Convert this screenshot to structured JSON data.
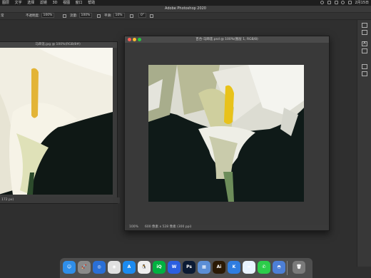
{
  "menubar": {
    "items": [
      "选择",
      "滤镜",
      "3D",
      "视图",
      "窗口",
      "帮助"
    ],
    "edge_items": [
      "图层",
      "文字"
    ],
    "clock": "2月15日"
  },
  "app": {
    "title": "Adobe Photoshop 2020"
  },
  "options": {
    "brush_mode": "正常",
    "opacity_label": "不透明度:",
    "opacity_value": "100%",
    "flow_label": "流量:",
    "flow_value": "100%",
    "smooth_label": "平滑:",
    "smooth_value": "10%",
    "angle_value": "0°",
    "left_edge_value": "常"
  },
  "doc_left": {
    "title": "马蹄莲.jpg @ 100%(RGB/8#)",
    "status": "172 px)"
  },
  "doc_front": {
    "title": "百合-马蹄莲.psd @ 100%(图层 1, RGB/8)",
    "zoom": "100%",
    "size": "600 像素 x 528 像素 (300 ppi)"
  },
  "right_panel": {
    "tools": [
      "brush-tool",
      "type-tool",
      "paragraph-tool",
      "adjustments-tool",
      "properties-tool"
    ]
  },
  "dock": {
    "apps": [
      {
        "name": "Finder",
        "label": "☺",
        "color": "#2f8ee8"
      },
      {
        "name": "Launchpad",
        "label": "🚀",
        "color": "#8a8a8a"
      },
      {
        "name": "Safari",
        "label": "◎",
        "color": "#2a6fd6"
      },
      {
        "name": "Chrome",
        "label": "◉",
        "color": "#e0e0e0"
      },
      {
        "name": "App Store",
        "label": "A",
        "color": "#1c8bf0"
      },
      {
        "name": "QQ",
        "label": "🐧",
        "color": "#eeeeee"
      },
      {
        "name": "iQIYI",
        "label": "iQ",
        "color": "#00b140"
      },
      {
        "name": "WPS",
        "label": "W",
        "color": "#2b5fe0"
      },
      {
        "name": "Photoshop",
        "label": "Ps",
        "color": "#0b1a33"
      },
      {
        "name": "Preview",
        "label": "▦",
        "color": "#5b8ed6"
      },
      {
        "name": "Illustrator",
        "label": "Ai",
        "color": "#2b1a05"
      },
      {
        "name": "Kuaishou",
        "label": "K",
        "color": "#2f7de0"
      },
      {
        "name": "Baidu Netdisk",
        "label": "∞",
        "color": "#e8f3ff"
      },
      {
        "name": "WeChat",
        "label": "✆",
        "color": "#2ccd4a"
      },
      {
        "name": "Storage",
        "label": "◓",
        "color": "#4d7fd6"
      },
      {
        "name": "Trash",
        "label": "🗑",
        "color": "#7a7a7a"
      }
    ]
  },
  "colors": {
    "traffic_close": "#ff5f57",
    "traffic_min": "#febc2e",
    "traffic_max": "#28c840"
  }
}
